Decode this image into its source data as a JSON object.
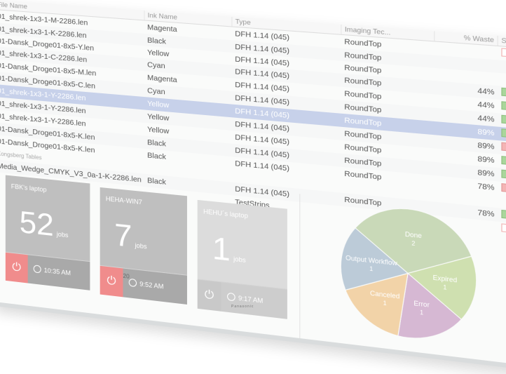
{
  "table": {
    "headers": [
      "File Name",
      "Ink Name",
      "Type",
      "Imaging Tec...",
      "% Waste",
      "State"
    ],
    "rows": [
      {
        "file": "01_shrek-1x3-1-M-2286.len",
        "ink": "Magenta",
        "type": "DFH 1.14 (045)",
        "imaging": "RoundTop",
        "waste": "",
        "state": "x"
      },
      {
        "file": "01_shrek-1x3-1-K-2286.len",
        "ink": "Black",
        "type": "DFH 1.14 (045)",
        "imaging": "RoundTop",
        "waste": "",
        "state": "none"
      },
      {
        "file": "01-Dansk_Droge01-8x5-Y.len",
        "ink": "Yellow",
        "type": "DFH 1.14 (045)",
        "imaging": "RoundTop",
        "waste": "",
        "state": "none"
      },
      {
        "file": "01_shrek-1x3-1-C-2286.len",
        "ink": "Cyan",
        "type": "DFH 1.14 (045)",
        "imaging": "RoundTop",
        "waste": "44%",
        "state": "green"
      },
      {
        "file": "01-Dansk_Droge01-8x5-M.len",
        "ink": "Magenta",
        "type": "DFH 1.14 (045)",
        "imaging": "RoundTop",
        "waste": "44%",
        "state": "green"
      },
      {
        "file": "01-Dansk_Droge01-8x5-C.len",
        "ink": "Cyan",
        "type": "DFH 1.14 (045)",
        "imaging": "RoundTop",
        "waste": "44%",
        "state": "green"
      },
      {
        "file": "01_shrek-1x3-1-Y-2286.len",
        "ink": "Yellow",
        "type": "DFH 1.14 (045)",
        "imaging": "RoundTop",
        "waste": "89%",
        "state": "green"
      },
      {
        "file": "01_shrek-1x3-1-Y-2286.len",
        "ink": "Yellow",
        "type": "DFH 1.14 (045)",
        "imaging": "RoundTop",
        "waste": "89%",
        "state": "red"
      },
      {
        "file": "01_shrek-1x3-1-Y-2286.len",
        "ink": "Yellow",
        "type": "DFH 1.14 (045)",
        "imaging": "RoundTop",
        "waste": "89%",
        "state": "green"
      },
      {
        "file": "01-Dansk_Droge01-8x5-K.len",
        "ink": "Black",
        "type": "DFH 1.14 (045)",
        "imaging": "RoundTop",
        "waste": "89%",
        "state": "green"
      },
      {
        "file": "01-Dansk_Droge01-8x5-K.len",
        "ink": "Black",
        "type": "DFH 1.14 (045)",
        "imaging": "RoundTop",
        "waste": "78%",
        "state": "red"
      },
      {
        "file": "Media_Wedge_CMYK_V3_0a-1-K-2286.len",
        "ink": "Black",
        "type": "DFH 1.14 (045)",
        "imaging": "RoundTop",
        "waste": "78%",
        "state": "green"
      },
      {
        "file": "",
        "ink": "",
        "type": "TestStrips",
        "imaging": "",
        "waste": "",
        "state": "x"
      }
    ],
    "selected_index": 6,
    "group_label": "Kongsberg Tables"
  },
  "machines": [
    {
      "name": "FBK's laptop",
      "count": "52",
      "unit": "jobs",
      "time": "10:35 AM",
      "power": "red"
    },
    {
      "name": "HEHA-WIN7",
      "count": "7",
      "unit": "jobs",
      "time": "9:52 AM",
      "power": "red"
    },
    {
      "name": "HEHU´s laptop",
      "count": "1",
      "unit": "jobs",
      "time": "9:17 AM",
      "power": "grey"
    }
  ],
  "cursor_label": "20",
  "pie": {
    "slices": [
      {
        "label": "Done",
        "value": 2,
        "color": "#c9d9b8"
      },
      {
        "label": "Expired",
        "value": 1,
        "color": "#cfe0b0"
      },
      {
        "label": "Error",
        "value": 1,
        "color": "#d6b8d3"
      },
      {
        "label": "Canceled",
        "value": 1,
        "color": "#f2d3a8"
      },
      {
        "label": "Output Workflow",
        "value": 1,
        "color": "#bccbd8"
      }
    ]
  },
  "bezel_brand": "Panasonic"
}
